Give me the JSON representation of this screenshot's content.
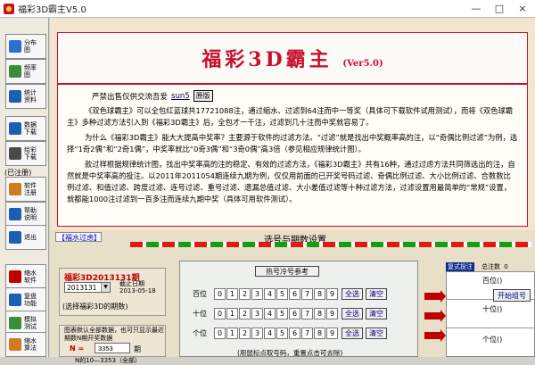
{
  "window": {
    "title": "福彩3D霸主V5.0",
    "controls": [
      "—",
      "□",
      "×"
    ]
  },
  "sidebar": {
    "buttons": [
      {
        "label": "分布图",
        "icon": "chart-icon",
        "color": "#2a6fd1"
      },
      {
        "label": "频率图",
        "icon": "bar-chart-icon",
        "color": "#3a8e3a"
      },
      {
        "label": "统计资料",
        "icon": "stats-icon",
        "color": "#1b5fb5"
      },
      {
        "label": "数据下载",
        "icon": "download-icon",
        "color": "#1b5fb5"
      },
      {
        "label": "给彩下载",
        "icon": "arrow-down-icon",
        "color": "#4a4a4a"
      }
    ],
    "register_label": "(已注册)",
    "buttons2": [
      {
        "label": "软件注册",
        "icon": "register-icon",
        "color": "#d07a22"
      },
      {
        "label": "帮助说明",
        "icon": "help-icon",
        "color": "#1b5fb5"
      },
      {
        "label": "退出",
        "icon": "exit-icon",
        "color": "#1b5fb5"
      }
    ],
    "buttons3": [
      {
        "label": "缩水软件",
        "icon": "cut-icon",
        "color": "#c00000"
      },
      {
        "label": "复盘功能",
        "icon": "replay-icon",
        "color": "#1b5fb5"
      },
      {
        "label": "模拟测试",
        "icon": "test-icon",
        "color": "#3a8e3a"
      },
      {
        "label": "缩水算法",
        "icon": "algo-icon",
        "color": "#d07a22"
      }
    ]
  },
  "header": {
    "title": "福彩3D霸主",
    "version": "(Ver5.0)"
  },
  "description": {
    "warning_prefix": "严禁出售仅供交流吾爱",
    "warning_link": "sun5",
    "warning_button": "原版",
    "paragraphs": [
      "《双色球霸主》可以全包红蓝球共17721088注，通过缩水、过滤到64注而中一等奖（具体可下载软件试用测试），而将《双色球霸主》多种过滤方法引入到《福彩3D霸主》后，全包才一千注，过滤到几十注而中奖就容易了。",
      "为什么《福彩3D霸主》能大大提高中奖率？主要源于软件的过滤方法。“过滤”就是找出中奖概率高的注，以“奇偶比例过滤”为例，选择“1奇2偶”和“2奇1偶”，中奖率就比“0奇3偶”和“3奇0偶”高3倍（参见相应规律统计图）。",
      "款过样根据规律统计图，找出中奖率高的注的稳定、有效的过滤方法，《福彩3D霸主》共有16种，通过过虑方法共同筛选出的注，自然就是中奖率高的投注。以2011年2011054期连续九期为例，仅仅用前面的已开奖号码过滤、奇偶比例过滤、大小比例过滤、合数数比例过滤、和值过滤、跨度过滤、连号过滤、重号过滤、遗漏总值过滤、大小差值过滤等十种过滤方法，过滤设置用最简单的“常规”设置，就都能1000注过滤到一百多注而连续九期中奖（具体可用软件测试）。"
    ]
  },
  "config": {
    "tab_label": "【福水过虑】",
    "title": "选号与期数设置",
    "period": {
      "caption": "福彩3D2013131期",
      "selected": "2013131",
      "open_label": "截止日期",
      "open_date": "2013-05-18",
      "hint": "(选择福彩3D的期数)"
    },
    "total": {
      "hint": "图表默认全部数据，也可只显示最近期数N期开奖数据",
      "n_label": "N =",
      "n_value": "3353",
      "n_unit": "期",
      "range": "N的10—3353（全部）"
    },
    "digits": {
      "hot_button": "热号冷号参考",
      "rows": [
        {
          "label": "百位",
          "values": [
            "0",
            "1",
            "2",
            "3",
            "4",
            "5",
            "6",
            "7",
            "8",
            "9"
          ],
          "all": "全选",
          "clear": "清空"
        },
        {
          "label": "十位",
          "values": [
            "0",
            "1",
            "2",
            "3",
            "4",
            "5",
            "6",
            "7",
            "8",
            "9"
          ],
          "all": "全选",
          "clear": "清空"
        },
        {
          "label": "个位",
          "values": [
            "0",
            "1",
            "2",
            "3",
            "4",
            "5",
            "6",
            "7",
            "8",
            "9"
          ],
          "all": "全选",
          "clear": "清空"
        }
      ],
      "footer": "(用鼠标点取号码，重置点击可去除)"
    },
    "result": {
      "tab": "复式投注",
      "total_label": "总注数",
      "total_value": "0",
      "positions": [
        "百位()",
        "十位()",
        "个位()"
      ]
    },
    "start_button": "开始组号"
  }
}
